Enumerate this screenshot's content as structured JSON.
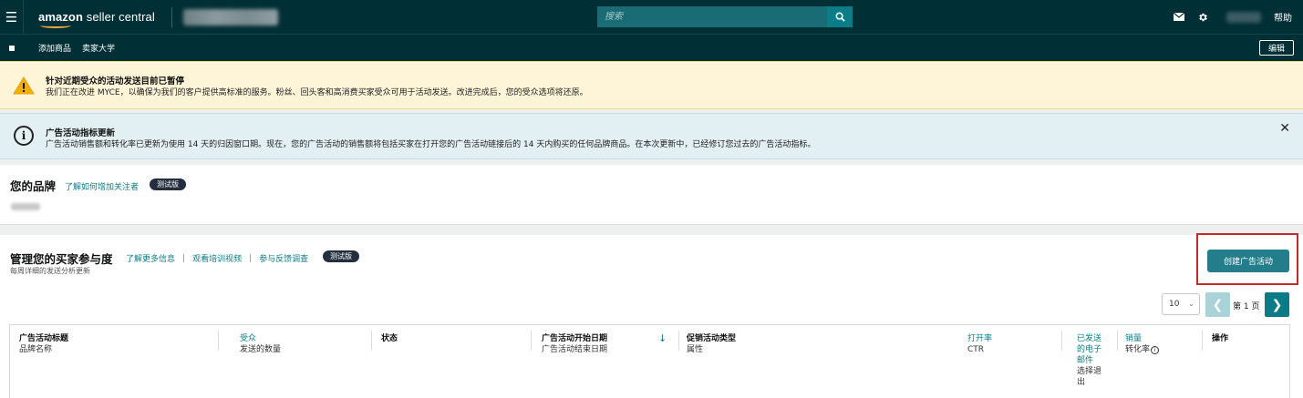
{
  "header": {
    "brand_prefix": "amazon",
    "brand_suffix": " seller central",
    "search_placeholder": "搜索",
    "help_label": "帮助",
    "icons": [
      "menu-icon",
      "search-icon",
      "mail-icon",
      "gear-icon"
    ]
  },
  "nav": {
    "items": [
      "添加商品",
      "卖家大学"
    ],
    "edit_label": "编辑"
  },
  "warning_banner": {
    "title": "针对近期受众的活动发送目前已暂停",
    "text": "我们正在改进 MYCE，以确保为我们的客户提供高标准的服务。粉丝、回头客和高消费买家受众可用于活动发送。改进完成后，您的受众选项将还原。"
  },
  "info_banner": {
    "title": "广告活动指标更新",
    "text": "广告活动销售额和转化率已更新为使用 14 天的归因窗口期。现在，您的广告活动的销售额将包括买家在打开您的广告活动链接后的 14 天内购买的任何品牌商品。在本次更新中，已经修订您过去的广告活动指标。"
  },
  "brand_section": {
    "title": "您的品牌",
    "link": "了解如何增加关注者",
    "badge": "测试版"
  },
  "engagement": {
    "title": "管理您的买家参与度",
    "links": [
      "了解更多信息",
      "观看培训视频",
      "参与反馈调查"
    ],
    "divider": "|",
    "badge": "测试版",
    "subtitle": "每周详细的发送分析更新",
    "create_button": "创建广告活动",
    "page_size": "10",
    "page_label": "第 1 页"
  },
  "table": {
    "columns": [
      {
        "main": "广告活动标题",
        "sub": "品牌名称",
        "teal": false
      },
      {
        "main": "受众",
        "sub": "发送的数量",
        "teal": true
      },
      {
        "main": "状态",
        "sub": "",
        "teal": false
      },
      {
        "main": "广告活动开始日期",
        "sub": "广告活动结束日期",
        "teal": false
      },
      {
        "main": "促销活动类型",
        "sub": "属性",
        "teal": false
      },
      {
        "main": "打开率",
        "sub": "CTR",
        "teal": true
      },
      {
        "main": "已发送的电子邮件",
        "sub": "选择退出",
        "teal": true
      },
      {
        "main": "销量",
        "sub": "转化率",
        "teal": true
      },
      {
        "main": "操作",
        "sub": "",
        "teal": false
      }
    ],
    "sent_email_lines": [
      "已发送",
      "的电子",
      "邮件"
    ],
    "opt_out_lines": [
      "选择退",
      "出"
    ]
  },
  "colors": {
    "header_bg": "#002f36",
    "accent_teal": "#0a7d86",
    "warning_bg": "#fef5d9",
    "info_bg": "#e3f0f3",
    "highlight_red": "#c12b2b"
  }
}
